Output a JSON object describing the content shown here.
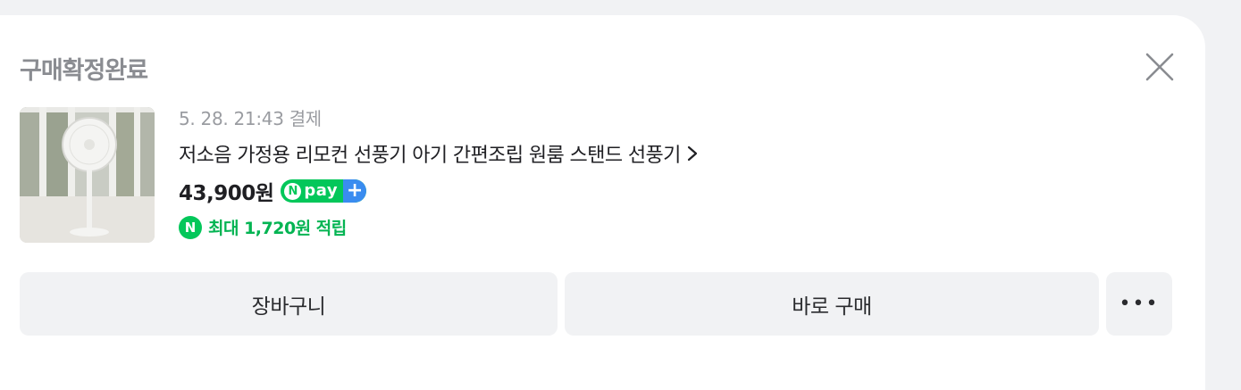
{
  "order": {
    "status_title": "구매확정완료",
    "paid_datetime": "5. 28. 21:43 결제",
    "product_name": "저소음 가정용 리모컨 선풍기 아기 간편조립 원룸 스탠드 선풍기",
    "chevron": "›",
    "price": "43,900원",
    "npay_n": "N",
    "npay_text": "pay",
    "npay_plus": "+",
    "reward_icon": "N",
    "reward_text": "최대 1,720원 적립"
  },
  "actions": {
    "cart_label": "장바구니",
    "buy_label": "바로 구매",
    "more_label": "•••"
  },
  "icons": {
    "close": "close-icon",
    "chevron": "chevron-right-icon",
    "npay": "npay-plus-icon",
    "reward": "naver-point-icon"
  },
  "colors": {
    "accent_green": "#03c75a",
    "plus_blue": "#3a8cf0",
    "muted_text": "#8a8c91",
    "button_bg": "#f1f2f4"
  }
}
